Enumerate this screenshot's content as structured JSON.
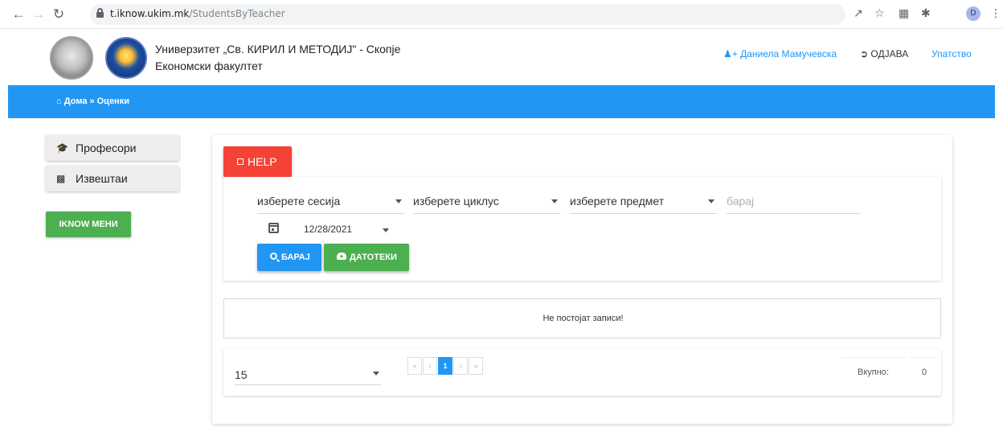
{
  "browser": {
    "url_host": "t.iknow.ukim.mk",
    "url_path": "/StudentsByTeacher",
    "profile_initial": "D"
  },
  "header": {
    "university": "Универзитет „Св. КИРИЛ И МЕТОДИЈ\" - Скопје",
    "faculty": "Економски факултет",
    "user": "Даниела Мамучевска",
    "logout": "ОДЈАВА",
    "guide": "Упатство"
  },
  "breadcrumb": {
    "home": "Дома",
    "current": "Оценки"
  },
  "sidebar": {
    "items": [
      {
        "label": "Професори",
        "icon": "graduation-cap-icon"
      },
      {
        "label": "Извештаи",
        "icon": "bar-chart-icon"
      }
    ],
    "iknow_button": "IKNOW МЕНИ"
  },
  "main": {
    "help_button": "HELP",
    "filters": {
      "session": "изберете сесија",
      "cycle": "изберете циклус",
      "subject": "изберете предмет",
      "search_placeholder": "барај",
      "date": "12/28/2021"
    },
    "search_button": "БАРАЈ",
    "files_button": "ДАТОТЕКИ",
    "empty_message": "Не постојат записи!",
    "page_size": "15",
    "pager": {
      "first": "«",
      "prev": "‹",
      "current": "1",
      "next": "›",
      "last": "»"
    },
    "total_label": "Вкупно:",
    "total_value": "0"
  },
  "colors": {
    "primary_blue": "#2196f3",
    "green": "#4caf50",
    "red": "#f44336"
  }
}
